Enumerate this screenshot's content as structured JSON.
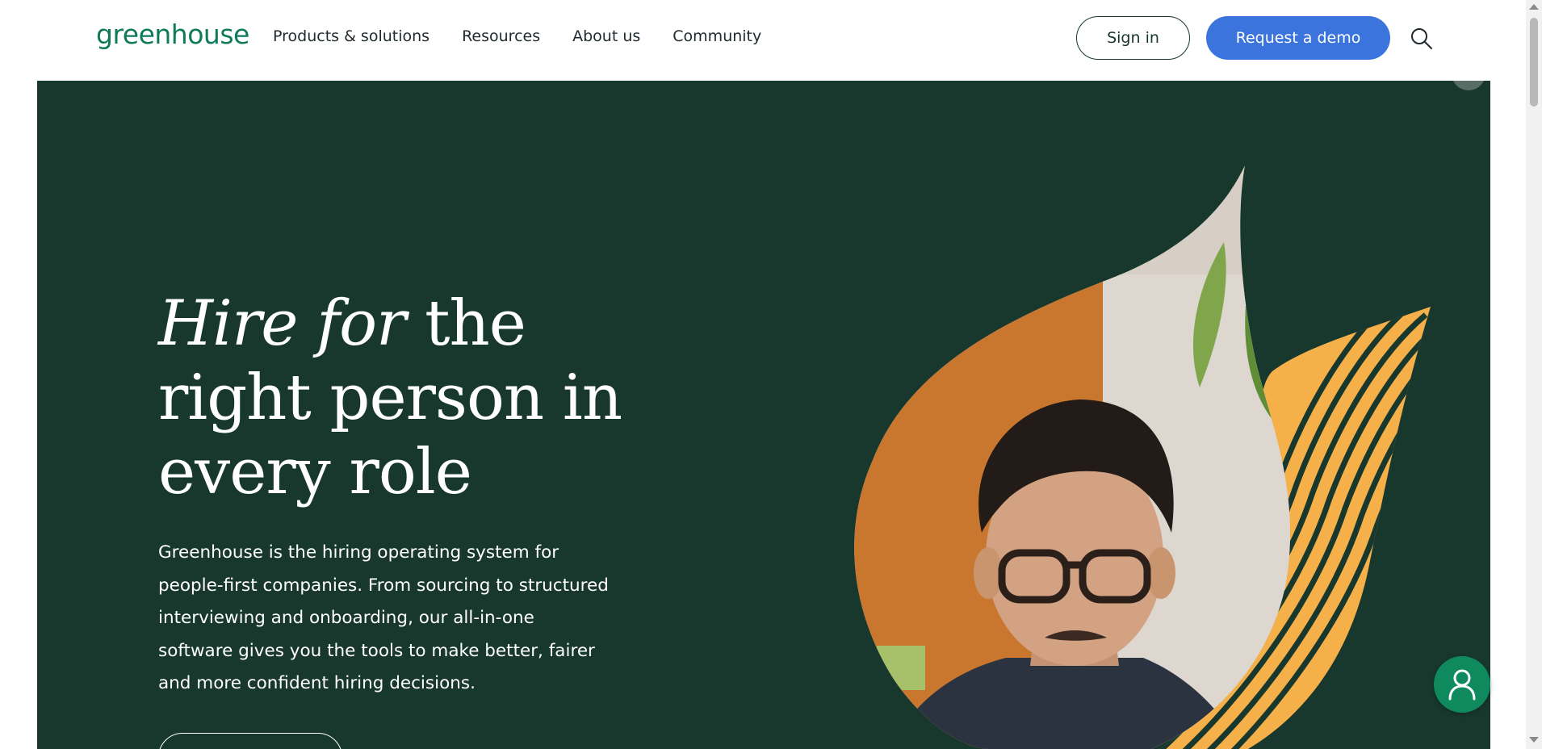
{
  "header": {
    "logo_text": "greenhouse",
    "nav": [
      {
        "label": "Products & solutions"
      },
      {
        "label": "Resources"
      },
      {
        "label": "About us"
      },
      {
        "label": "Community"
      }
    ],
    "sign_in_label": "Sign in",
    "demo_label": "Request a demo",
    "search_icon": "search-icon"
  },
  "hero": {
    "title_italic": "Hire for",
    "title_rest_line1": " the",
    "title_line2": "right person in",
    "title_line3": "every role",
    "description": "Greenhouse is the hiring operating system for people-first companies. From sourcing to structured interviewing and onboarding, our all-in-one software gives you the tools to make better, fairer and more confident hiring decisions."
  },
  "colors": {
    "brand_green": "#0f7a5a",
    "hero_bg": "#18382e",
    "demo_blue": "#3b74dc",
    "accent_orange": "#f5b04a",
    "chat_green": "#0f8a5f"
  },
  "chat": {
    "icon": "person-icon"
  }
}
